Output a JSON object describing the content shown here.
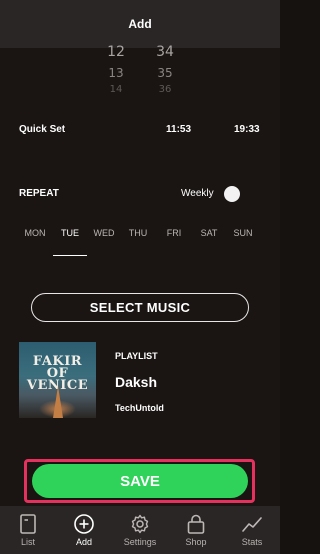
{
  "header": {
    "title": "Add"
  },
  "time_picker": {
    "rows": [
      {
        "hour": "12",
        "minute": "34"
      },
      {
        "hour": "13",
        "minute": "35"
      },
      {
        "hour": "14",
        "minute": "36"
      }
    ]
  },
  "quick_set": {
    "label": "Quick Set",
    "times": [
      "11:53",
      "19:33"
    ]
  },
  "repeat": {
    "label": "REPEAT",
    "mode_label": "Weekly",
    "mode_on": false
  },
  "days": {
    "items": [
      "MON",
      "TUE",
      "WED",
      "THU",
      "FRI",
      "SAT",
      "SUN"
    ],
    "selected": "TUE"
  },
  "select_music": {
    "label": "SELECT MUSIC"
  },
  "playlist": {
    "tag": "PLAYLIST",
    "name": "Daksh",
    "owner": "TechUntold",
    "album_art_text": "FAKIR OF VENICE"
  },
  "save": {
    "label": "SAVE",
    "color": "#2fd35a",
    "highlight_color": "#e5315d"
  },
  "tabbar": {
    "items": [
      {
        "label": "List",
        "icon": "list-icon"
      },
      {
        "label": "Add",
        "icon": "add-circle-icon",
        "active": true
      },
      {
        "label": "Settings",
        "icon": "gear-icon"
      },
      {
        "label": "Shop",
        "icon": "bag-icon"
      },
      {
        "label": "Stats",
        "icon": "chart-line-icon"
      }
    ]
  }
}
